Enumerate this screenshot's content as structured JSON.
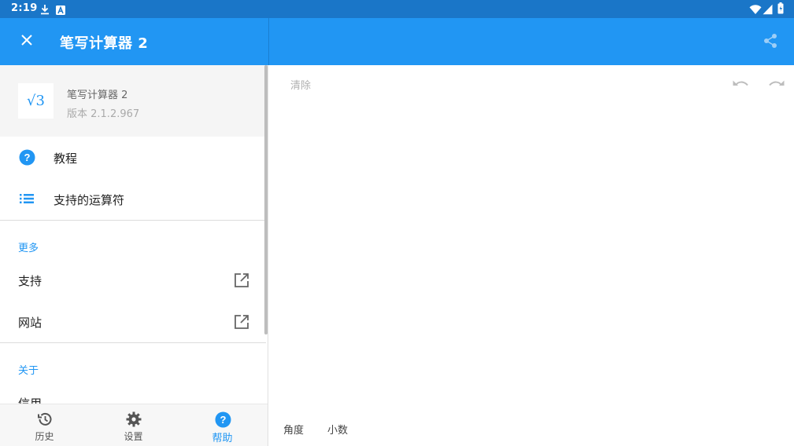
{
  "status_bar": {
    "time": "2:19",
    "left_icons": [
      "download-icon",
      "a-badge-icon"
    ],
    "right_icons": [
      "wifi-icon",
      "signal-icon",
      "battery-icon"
    ],
    "color": "#1a76c8"
  },
  "app_bar": {
    "title": "笔写计算器 2",
    "color": "#2196f3",
    "close_icon": "close-icon",
    "share_icon": "share-icon"
  },
  "drawer": {
    "header": {
      "logo_text": "√3",
      "app_name": "笔写计算器 2",
      "version": "版本 2.1.2.967"
    },
    "primary_items": [
      {
        "label": "教程",
        "icon": "help-circle-icon"
      },
      {
        "label": "支持的运算符",
        "icon": "list-icon"
      }
    ],
    "more_section": {
      "title": "更多",
      "items": [
        {
          "label": "支持",
          "icon": "open-external-icon"
        },
        {
          "label": "网站",
          "icon": "open-external-icon"
        }
      ]
    },
    "about_section": {
      "title": "关于",
      "items": [
        {
          "label": "信用"
        }
      ]
    },
    "bottom_nav": [
      {
        "label": "历史",
        "icon": "history-icon",
        "active": false
      },
      {
        "label": "设置",
        "icon": "gear-icon",
        "active": false
      },
      {
        "label": "帮助",
        "icon": "help-circle-icon",
        "active": true
      }
    ]
  },
  "canvas": {
    "clear_label": "清除",
    "undo_icon": "undo-icon",
    "redo_icon": "redo-icon",
    "angle_mode_label": "角度",
    "decimal_mode_label": "小数"
  },
  "colors": {
    "accent": "#2196f3",
    "status_bar": "#1a76c8",
    "drawer_header_bg": "#f5f5f5"
  }
}
